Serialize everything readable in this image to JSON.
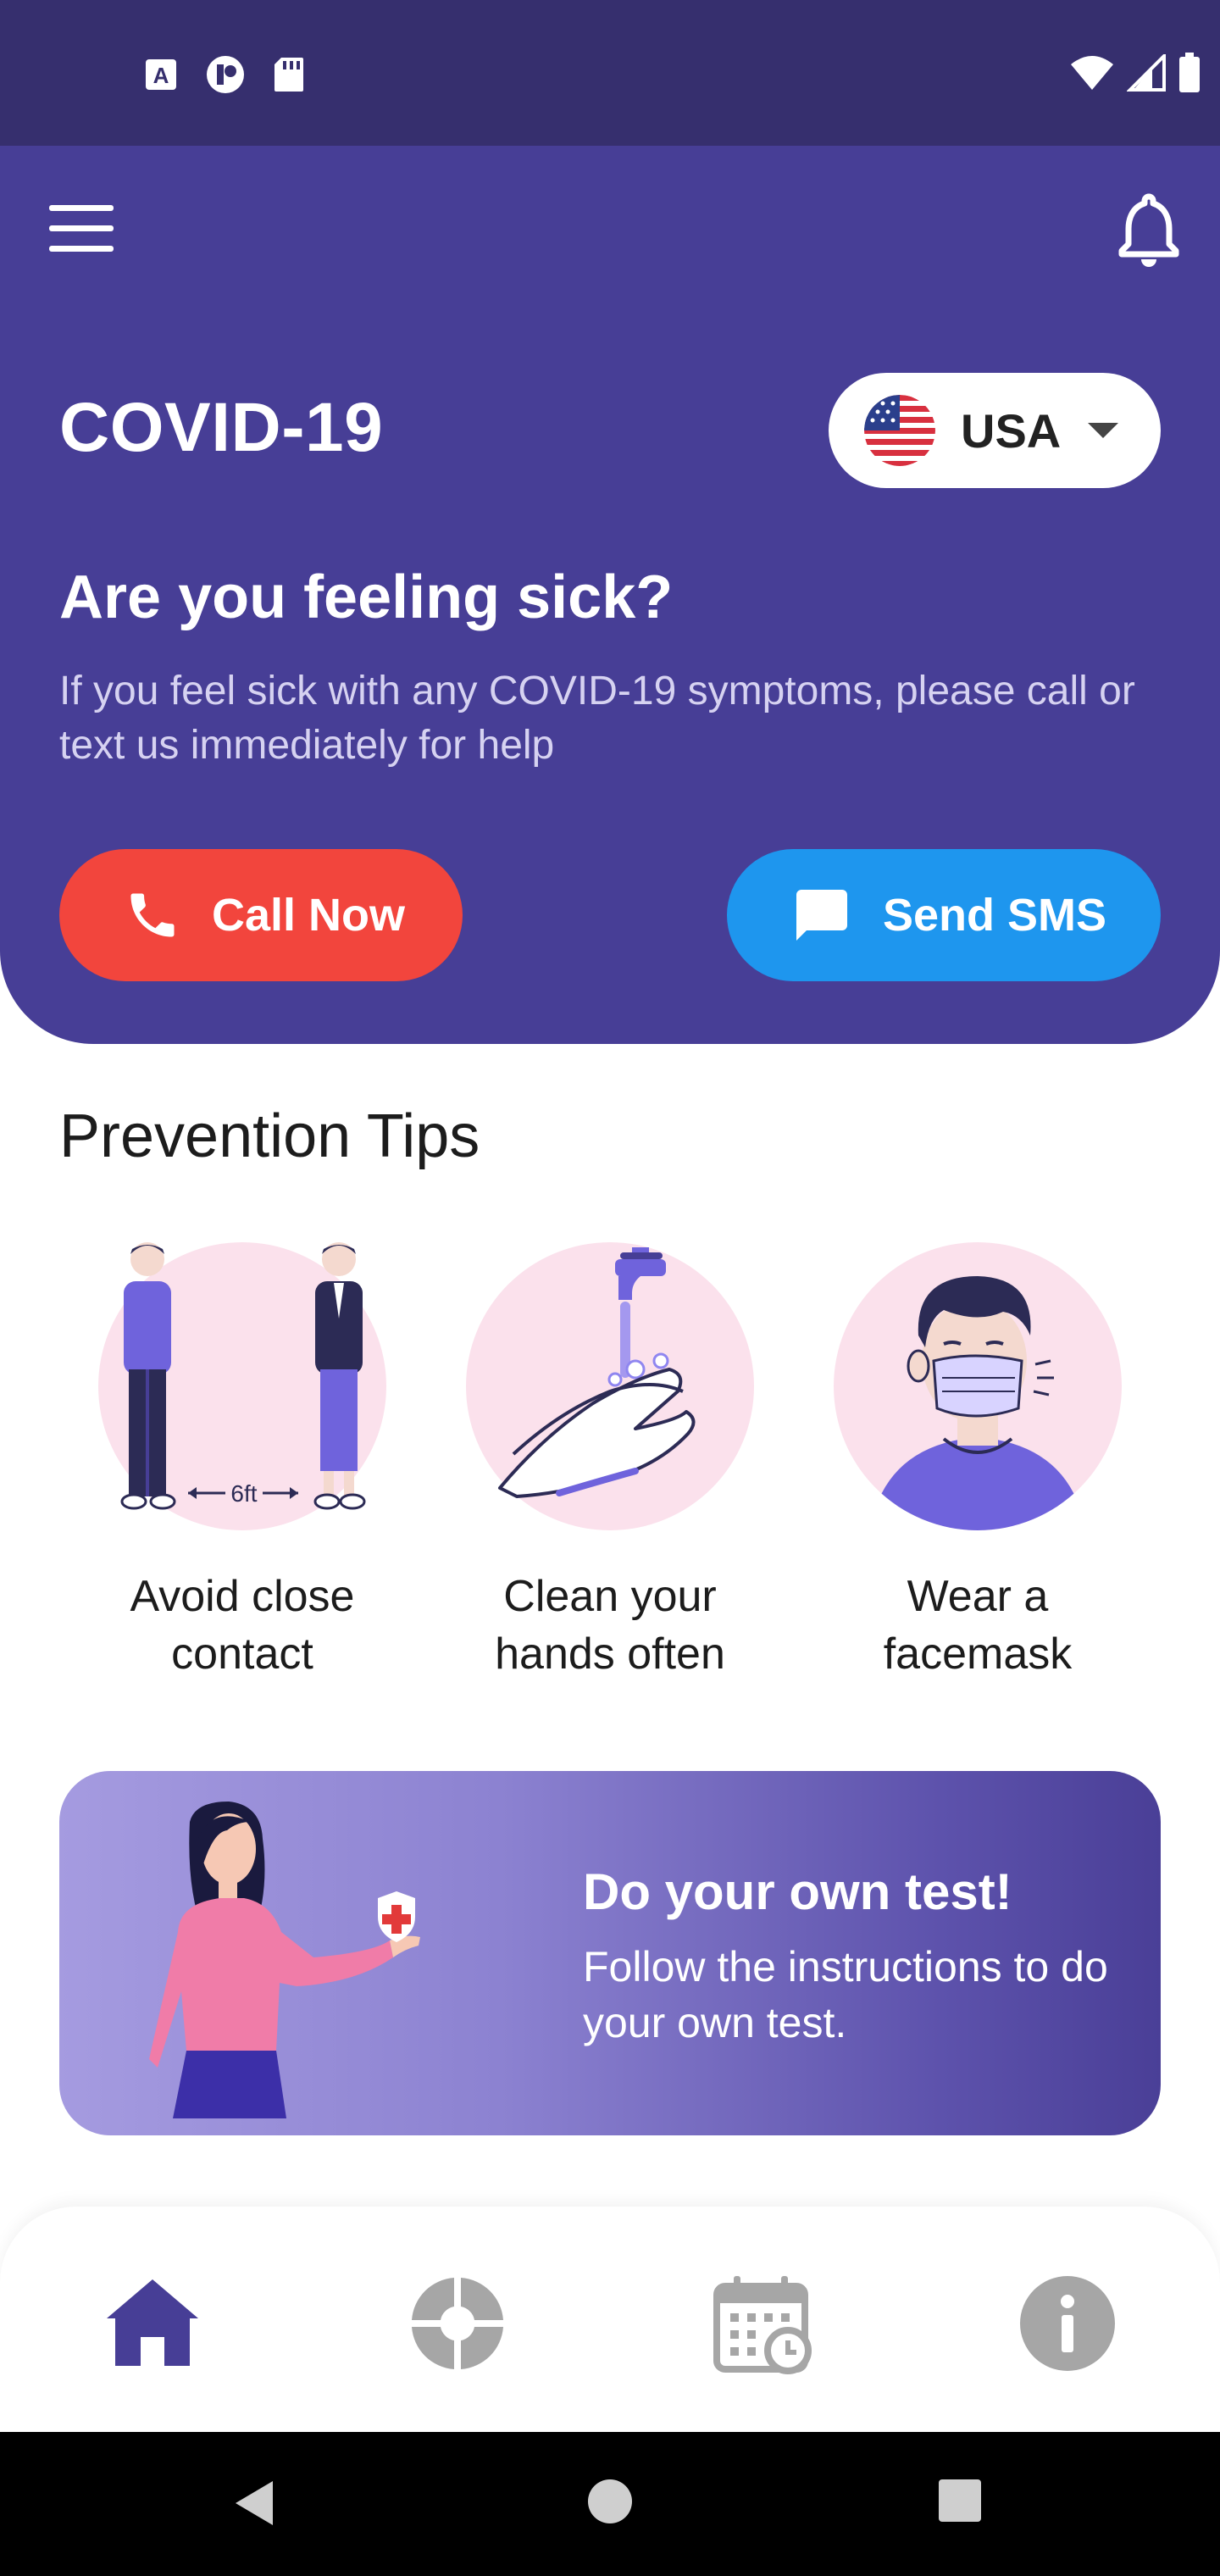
{
  "colors": {
    "status_bar": "#362f6e",
    "header_bg": "#473e96",
    "call_button": "#f2453d",
    "sms_button": "#1e96ee",
    "nav_active": "#473e96",
    "nav_inactive": "#a6a6a6"
  },
  "status_bar": {
    "left_icons": [
      "autofill-a-icon",
      "app-circle-icon",
      "sd-card-icon"
    ],
    "right_icons": [
      "wifi-icon",
      "signal-icon",
      "battery-icon"
    ]
  },
  "header": {
    "menu_icon": "hamburger-menu-icon",
    "notification_icon": "bell-icon",
    "title": "COVID-19",
    "country": {
      "label": "USA",
      "flag_icon": "usa-flag-icon"
    },
    "question": "Are you feeling sick?",
    "description": "If you feel sick with any COVID-19 symptoms, please call or text us immediately for help",
    "call_button": "Call Now",
    "sms_button": "Send SMS"
  },
  "prevention": {
    "title": "Prevention Tips",
    "tips": [
      {
        "label": "Avoid close contact",
        "icon": "social-distance-illustration",
        "distance_text": "6ft"
      },
      {
        "label": "Clean your hands often",
        "icon": "hand-washing-illustration"
      },
      {
        "label": "Wear a facemask",
        "icon": "facemask-illustration"
      }
    ]
  },
  "test_card": {
    "title": "Do your own test!",
    "description": "Follow the instructions to do your own test."
  },
  "bottom_nav": {
    "items": [
      {
        "icon": "home-icon",
        "active": true
      },
      {
        "icon": "pie-chart-icon",
        "active": false
      },
      {
        "icon": "calendar-clock-icon",
        "active": false
      },
      {
        "icon": "info-icon",
        "active": false
      }
    ]
  },
  "system_nav": [
    "back-icon",
    "home-circle-icon",
    "recents-square-icon"
  ]
}
